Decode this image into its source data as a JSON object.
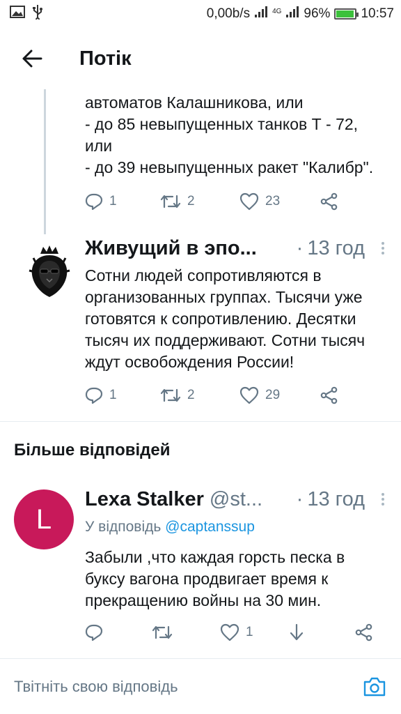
{
  "status_bar": {
    "net_speed": "0,00b/s",
    "network_type": "4G",
    "battery_percent": "96%",
    "battery_level": 0.96,
    "time": "10:57",
    "icons": [
      "image-icon",
      "usb-icon",
      "signal-icon",
      "signal-icon",
      "battery-icon"
    ]
  },
  "header": {
    "back_icon": "arrow-left-icon",
    "title": "Потік"
  },
  "thread_tweet": {
    "text_lines": [
      "автоматов Калашникова, или",
      "- до 85 невыпущенных танков Т - 72,",
      "или",
      "- до 39 невыпущенных ракет \"Калибр\"."
    ],
    "replies": "1",
    "retweets": "2",
    "likes": "23"
  },
  "tweet": {
    "name": "Живущий в эпо...",
    "time": "13 год",
    "text_lines": [
      "Сотни людей сопротивляются в",
      "организованных группах. Тысячи уже",
      "готовятся к сопротивлению. Десятки",
      "тысяч их поддерживают. Сотни тысяч",
      "ждут освобождения России!"
    ],
    "replies": "1",
    "retweets": "2",
    "likes": "29"
  },
  "more_replies": {
    "title": "Більше відповідей"
  },
  "reply_tweet": {
    "avatar_letter": "L",
    "avatar_color": "#c8195a",
    "name": "Lexa Stalker",
    "handle": "@st...",
    "time": "13 год",
    "replying_to_label": "У відповідь",
    "replying_to_mention": "@captanssup",
    "text_lines": [
      "Забыли ,что каждая  горсть песка в",
      "буксу вагона продвигает время к",
      "прекращению войны на 30 мин."
    ],
    "likes": "1"
  },
  "compose": {
    "placeholder": "Твітніть свою відповідь"
  },
  "colors": {
    "accent": "#1b95e0",
    "secondary_text": "#657786",
    "thread_line": "#cdd6dd"
  }
}
